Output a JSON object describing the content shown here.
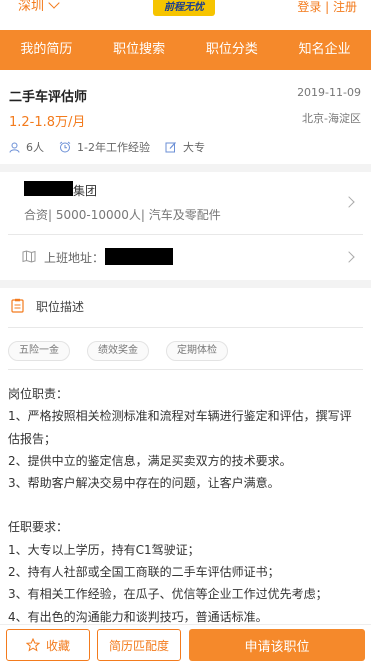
{
  "header": {
    "city": "深圳",
    "logo_text": "前程无忧",
    "auth": "登录 | 注册"
  },
  "nav": {
    "items": [
      "我的简历",
      "职位搜索",
      "职位分类",
      "知名企业"
    ]
  },
  "job": {
    "title": "二手车评估师",
    "date": "2019-11-09",
    "salary": "1.2-1.8万/月",
    "location": "北京-海淀区",
    "headcount": "6人",
    "experience": "1-2年工作经验",
    "education": "大专"
  },
  "company": {
    "name_suffix": "集团",
    "info": "合资| 5000-10000人| 汽车及零配件"
  },
  "address": {
    "label": "上班地址："
  },
  "description": {
    "title": "职位描述",
    "tags": [
      "五险一金",
      "绩效奖金",
      "定期体检"
    ],
    "duties_title": "岗位职责：",
    "duties": [
      "1、严格按照相关检测标准和流程对车辆进行鉴定和评估，撰写评估报告；",
      "2、提供中立的鉴定信息，满足买卖双方的技术要求。",
      "3、帮助客户解决交易中存在的问题，让客户满意。"
    ],
    "requirements_title": "任职要求：",
    "requirements": [
      "1、大专以上学历，持有C1驾驶证；",
      "2、持有人社部或全国工商联的二手车评估师证书；",
      "3、有相关工作经验，在瓜子、优信等企业工作过优先考虑；",
      "4、有出色的沟通能力和谈判技巧，普通话标准。"
    ]
  },
  "actions": {
    "favorite": "收藏",
    "match": "简历匹配度",
    "apply": "申请该职位"
  },
  "colors": {
    "accent": "#f5892b",
    "text_orange": "#f37b1d"
  }
}
